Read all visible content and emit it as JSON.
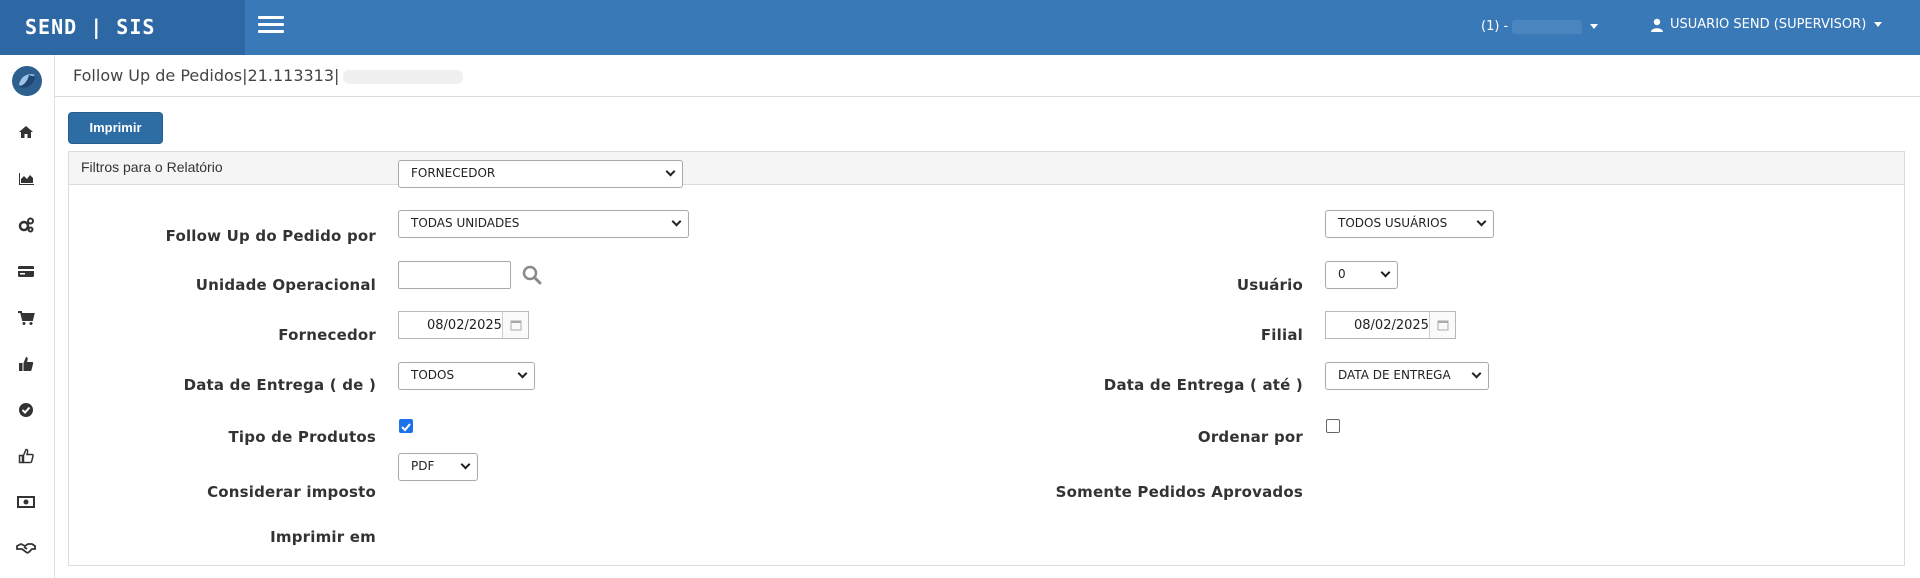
{
  "topbar": {
    "brand": "SEND | SIS",
    "company": "(1) -",
    "user": "USUARIO SEND (SUPERVISOR)"
  },
  "sidebar": {
    "icons": [
      "home-icon",
      "area-chart-icon",
      "cogs-icon",
      "credit-card-icon",
      "cart-icon",
      "thumbs-up-solid-icon",
      "check-circle-icon",
      "thumbs-up-outline-icon",
      "money-icon",
      "handshake-icon"
    ]
  },
  "page": {
    "title": "Follow Up de Pedidos|21.113313|",
    "print_label": "Imprimir",
    "panel_title": "Filtros para o Relatório"
  },
  "filters": {
    "followup_by": {
      "label": "Follow Up do Pedido por",
      "value": "FORNECEDOR"
    },
    "unit": {
      "label": "Unidade Operacional",
      "value": "TODAS UNIDADES"
    },
    "user": {
      "label": "Usuário",
      "value": "TODOS USUÁRIOS"
    },
    "supplier": {
      "label": "Fornecedor",
      "value": ""
    },
    "branch": {
      "label": "Filial",
      "value": "0"
    },
    "date_from": {
      "label": "Data de Entrega ( de )",
      "value": "08/02/2025"
    },
    "date_to": {
      "label": "Data de Entrega ( até )",
      "value": "08/02/2025"
    },
    "product_type": {
      "label": "Tipo de Produtos",
      "value": "TODOS"
    },
    "order_by": {
      "label": "Ordenar por",
      "value": "DATA DE ENTREGA"
    },
    "consider_tax": {
      "label": "Considerar imposto",
      "checked": true
    },
    "approved_only": {
      "label": "Somente Pedidos Aprovados",
      "checked": false
    },
    "print_format": {
      "label": "Imprimir em",
      "value": "PDF"
    }
  },
  "colors": {
    "topbar": "#3a79b8",
    "brand_bg": "#2d68a4",
    "button": "#2e6da4",
    "checkbox_on": "#1a73e8"
  }
}
